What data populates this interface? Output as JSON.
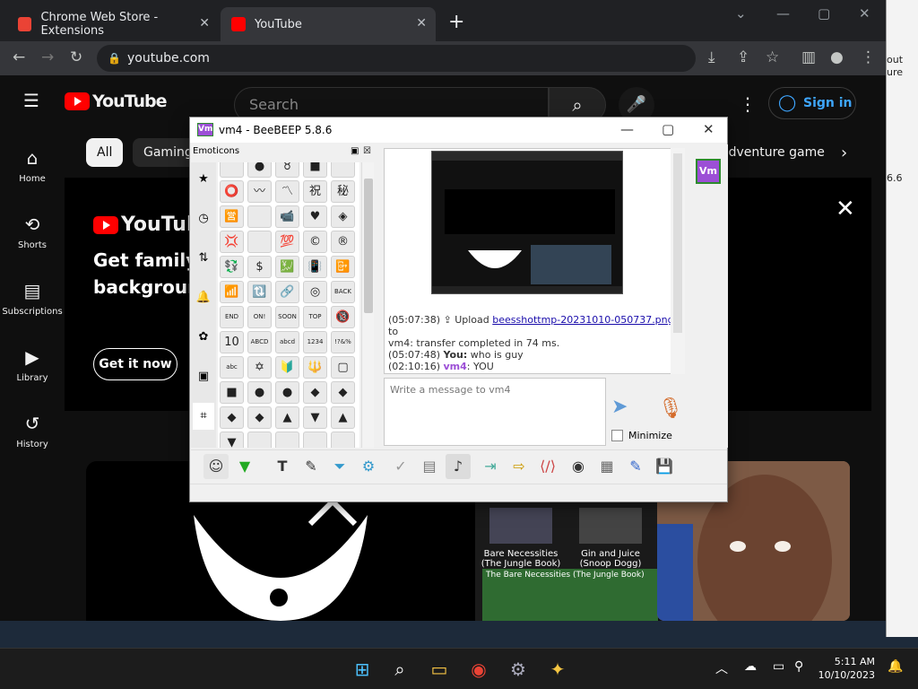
{
  "browser": {
    "tabs": [
      {
        "title": "Chrome Web Store - Extensions",
        "color": "#ea4335"
      },
      {
        "title": "YouTube",
        "color": "#ff0000"
      }
    ],
    "url": "youtube.com"
  },
  "bg_window": {
    "line1": "out",
    "line2": "ure",
    "line3": "6.6"
  },
  "youtube": {
    "logo": "YouTube",
    "search_placeholder": "Search",
    "sign_in": "Sign in",
    "sidebar": [
      {
        "label": "Home",
        "icon": "home-icon",
        "glyph": "⌂"
      },
      {
        "label": "Shorts",
        "icon": "shorts-icon",
        "glyph": "⟲"
      },
      {
        "label": "Subscriptions",
        "icon": "subscriptions-icon",
        "glyph": "▤"
      },
      {
        "label": "Library",
        "icon": "library-icon",
        "glyph": "▶"
      },
      {
        "label": "History",
        "icon": "history-icon",
        "glyph": "↺"
      }
    ],
    "chips": [
      "All",
      "Gaming",
      "adventure game"
    ],
    "promo": {
      "logo": "YouTube",
      "line1": "Get family p",
      "line2": "backgroun",
      "button": "Get it now"
    },
    "songs": [
      {
        "line1": "Bare Necessities",
        "line2": "(The Jungle Book)"
      },
      {
        "line1": "Gin and Juice",
        "line2": "(Snoop Dogg)"
      }
    ],
    "wave_label": "The Bare Necessities (The Jungle Book)"
  },
  "beebeep": {
    "title": "vm4 - BeeBEEP 5.8.6",
    "badge": "Vm",
    "emoticons_title": "Emoticons",
    "grid": [
      [
        "",
        "●",
        "♉",
        "■",
        ""
      ],
      [
        "⭕",
        "〰",
        "〽",
        "祝",
        "秘"
      ],
      [
        "🈺",
        "",
        "📹",
        "♥",
        "◈"
      ],
      [
        "💢",
        "",
        "💯",
        "©",
        "®"
      ],
      [
        "💱",
        "$",
        "💹",
        "📳",
        "📴"
      ],
      [
        "📶",
        "🔃",
        "🔗",
        "◎",
        "BACK"
      ],
      [
        "END",
        "ON!",
        "SOON",
        "TOP",
        "🔞"
      ],
      [
        "10",
        "ABCD",
        "abcd",
        "1234",
        "!?&%"
      ],
      [
        "abc",
        "✡",
        "🔰",
        "🔱",
        "▢"
      ],
      [
        "■",
        "●",
        "●",
        "◆",
        "◆"
      ],
      [
        "◆",
        "◆",
        "▲",
        "▼",
        "▲"
      ],
      [
        "▼",
        "",
        "",
        "",
        ""
      ]
    ],
    "chat": {
      "line1_time": "(05:07:38)",
      "line1_text": "Upload",
      "line1_link": "beesshottmp-20231010-050737.png",
      "line1_tail": "to",
      "line2": "vm4: transfer completed in 74 ms.",
      "line3_time": "(05:07:48)",
      "line3_user": "You:",
      "line3_msg": "who is guy",
      "line4_time": "(02:10:16)",
      "line4_user": "vm4",
      "line4_msg": ": YOU"
    },
    "input_placeholder": "Write a message to vm4",
    "minimize_label": "Minimize",
    "user_color": "#9c4fd6"
  },
  "taskbar": {
    "time": "5:11 AM",
    "date": "10/10/2023"
  }
}
